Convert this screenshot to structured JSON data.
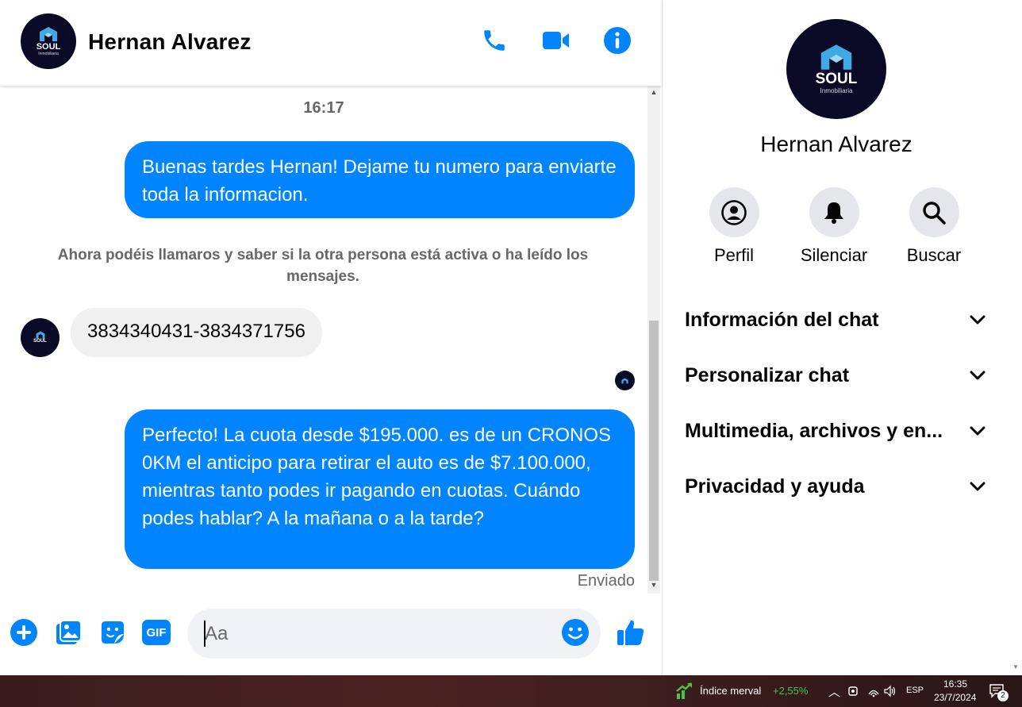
{
  "header": {
    "contact_name": "Hernan Alvarez",
    "avatar_brand": "SOUL",
    "avatar_sub": "Inmobiliaria"
  },
  "conversation": {
    "timestamp": "16:17",
    "messages": [
      {
        "direction": "outgoing",
        "text": "Buenas tardes Hernan! Dejame tu numero para enviarte toda la informacion."
      },
      {
        "direction": "incoming",
        "text": "3834340431-3834371756"
      },
      {
        "direction": "outgoing",
        "text": "Perfecto! La cuota desde $195.000. es de un CRONOS 0KM el anticipo para retirar el auto es de $7.100.000, mientras tanto podes ir pagando en cuotas. Cuándo podes hablar? A la mañana o a la tarde?"
      }
    ],
    "system_note": "Ahora podéis llamaros y saber si la otra persona está activa o ha leído los mensajes.",
    "sent_status": "Enviado"
  },
  "composer": {
    "placeholder": "Aa",
    "gif_label": "GIF"
  },
  "info_panel": {
    "contact_name": "Hernan Alvarez",
    "actions": [
      {
        "label": "Perfil",
        "icon": "profile-icon"
      },
      {
        "label": "Silenciar",
        "icon": "bell-icon"
      },
      {
        "label": "Buscar",
        "icon": "search-icon"
      }
    ],
    "sections": [
      {
        "label": "Información del chat"
      },
      {
        "label": "Personalizar chat"
      },
      {
        "label": "Multimedia, archivos y en..."
      },
      {
        "label": "Privacidad y ayuda"
      }
    ]
  },
  "taskbar": {
    "ticker_name": "Índice merval",
    "ticker_change": "+2,55%",
    "language": "ESP",
    "time": "16:35",
    "date": "23/7/2024",
    "notification_count": "2"
  },
  "colors": {
    "accent": "#0084ff",
    "incoming_bubble": "#f0f0f0",
    "muted_text": "#65676b",
    "avatar_bg": "#0b0a26",
    "ticker_up": "#4cc24c"
  }
}
